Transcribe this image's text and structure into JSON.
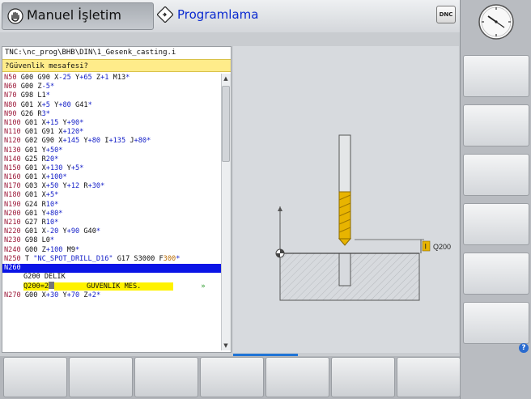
{
  "header": {
    "mode_manual_label": "Manuel İşletim",
    "mode_programming_label": "Programlama",
    "dnc_label": "DNC"
  },
  "program": {
    "path": "TNC:\\nc_prog\\BHB\\DIN\\1_Gesenk_casting.i",
    "prompt": "?Güvenlik mesafesi?",
    "lines": [
      {
        "n": "N50",
        "code": " G00 G90 X-25 Y+65 Z+1 M13*"
      },
      {
        "n": "N60",
        "code": " G00 Z-5*"
      },
      {
        "n": "N70",
        "code": " G98 L1*"
      },
      {
        "n": "N80",
        "code": " G01 X+5 Y+80 G41*"
      },
      {
        "n": "N90",
        "code": " G26 R3*"
      },
      {
        "n": "N100",
        "code": " G01 X+15 Y+90*"
      },
      {
        "n": "N110",
        "code": " G01 G91 X+120*"
      },
      {
        "n": "N120",
        "code": " G02 G90 X+145 Y+80 I+135 J+80*"
      },
      {
        "n": "N130",
        "code": " G01 Y+50*"
      },
      {
        "n": "N140",
        "code": " G25 R20*"
      },
      {
        "n": "N150",
        "code": " G01 X+130 Y+5*"
      },
      {
        "n": "N160",
        "code": " G01 X+100*"
      },
      {
        "n": "N170",
        "code": " G03 X+50 Y+12 R+30*"
      },
      {
        "n": "N180",
        "code": " G01 X+5*"
      },
      {
        "n": "N190",
        "code": " G24 R10*"
      },
      {
        "n": "N200",
        "code": " G01 Y+80*"
      },
      {
        "n": "N210",
        "code": " G27 R10*"
      },
      {
        "n": "N220",
        "code": " G01 X-20 Y+90 G40*"
      },
      {
        "n": "N230",
        "code": " G98 L0*"
      },
      {
        "n": "N240",
        "code": " G00 Z+100 M9*"
      },
      {
        "n": "N250",
        "code": " T \"NC_SPOT_DRILL_D16\" G17 S3000 F300*"
      }
    ],
    "active_line": "N260",
    "cycle_line": "G200 DELIK",
    "param_line": {
      "name": "Q200=2",
      "label": "GUVENLIK MES.",
      "more": "»"
    },
    "next_line": {
      "n": "N270",
      "code": " G00 X+30 Y+70 Z+2*"
    }
  },
  "graphic": {
    "param_label": "Q200",
    "param_marker": "I"
  },
  "help_label": "?",
  "colors": {
    "prompt_bg": "#ffec8a",
    "active_line_bg": "#0a14e6",
    "tool": "#e8b400",
    "block_numbers": "#9c1a3a",
    "values": "#1520c8"
  }
}
